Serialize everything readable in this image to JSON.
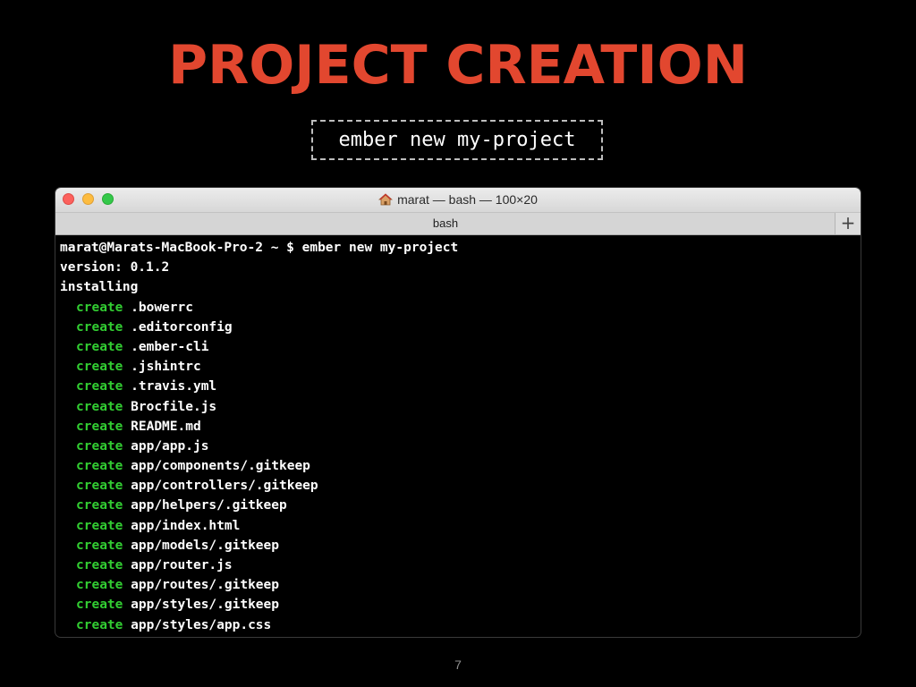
{
  "slide": {
    "title": "PROJECT CREATION",
    "command": "ember new my-project",
    "page_number": "7",
    "title_color": "#e2472f"
  },
  "terminal_window": {
    "title": "marat — bash — 100×20",
    "title_icon": "home-icon",
    "tab_label": "bash",
    "new_tab_label": "+",
    "traffic_lights": [
      "close",
      "minimize",
      "maximize"
    ],
    "create_color": "#32cd32",
    "lines": [
      {
        "text": "marat@Marats-MacBook-Pro-2 ~ $ ember new my-project"
      },
      {
        "text": "version: 0.1.2"
      },
      {
        "text": "installing"
      },
      {
        "keyword": "create",
        "text": ".bowerrc"
      },
      {
        "keyword": "create",
        "text": ".editorconfig"
      },
      {
        "keyword": "create",
        "text": ".ember-cli"
      },
      {
        "keyword": "create",
        "text": ".jshintrc"
      },
      {
        "keyword": "create",
        "text": ".travis.yml"
      },
      {
        "keyword": "create",
        "text": "Brocfile.js"
      },
      {
        "keyword": "create",
        "text": "README.md"
      },
      {
        "keyword": "create",
        "text": "app/app.js"
      },
      {
        "keyword": "create",
        "text": "app/components/.gitkeep"
      },
      {
        "keyword": "create",
        "text": "app/controllers/.gitkeep"
      },
      {
        "keyword": "create",
        "text": "app/helpers/.gitkeep"
      },
      {
        "keyword": "create",
        "text": "app/index.html"
      },
      {
        "keyword": "create",
        "text": "app/models/.gitkeep"
      },
      {
        "keyword": "create",
        "text": "app/router.js"
      },
      {
        "keyword": "create",
        "text": "app/routes/.gitkeep"
      },
      {
        "keyword": "create",
        "text": "app/styles/.gitkeep"
      },
      {
        "keyword": "create",
        "text": "app/styles/app.css"
      }
    ]
  }
}
